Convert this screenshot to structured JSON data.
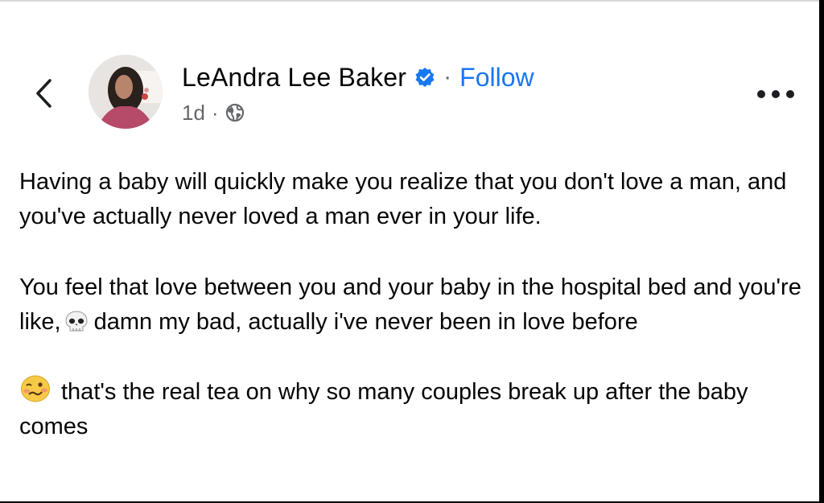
{
  "header": {
    "back_icon": "chevron-left-icon",
    "author_name": "LeAndra Lee Baker",
    "verified_icon": "verified-badge-icon",
    "separator": "·",
    "follow_label": "Follow",
    "timestamp": "1d",
    "meta_separator": "·",
    "privacy_icon": "globe-icon",
    "more_icon": "more-options-icon"
  },
  "post": {
    "paragraph_1": "Having a baby will quickly make you realize that you don't love a man, and you've actually never loved a man ever in your life.",
    "paragraph_2_before": "You feel that love between you and your baby in the hospital bed and you're like,",
    "paragraph_2_emoji": "skull-emoji",
    "paragraph_2_after": "damn my bad, actually i've never been in love before",
    "paragraph_3_emoji": "woozy-face-emoji",
    "paragraph_3_text": "that's the real tea on why so many couples break up after the baby comes"
  },
  "colors": {
    "text": "#050505",
    "secondary": "#65676b",
    "accent": "#1877f2",
    "background": "#ffffff"
  }
}
